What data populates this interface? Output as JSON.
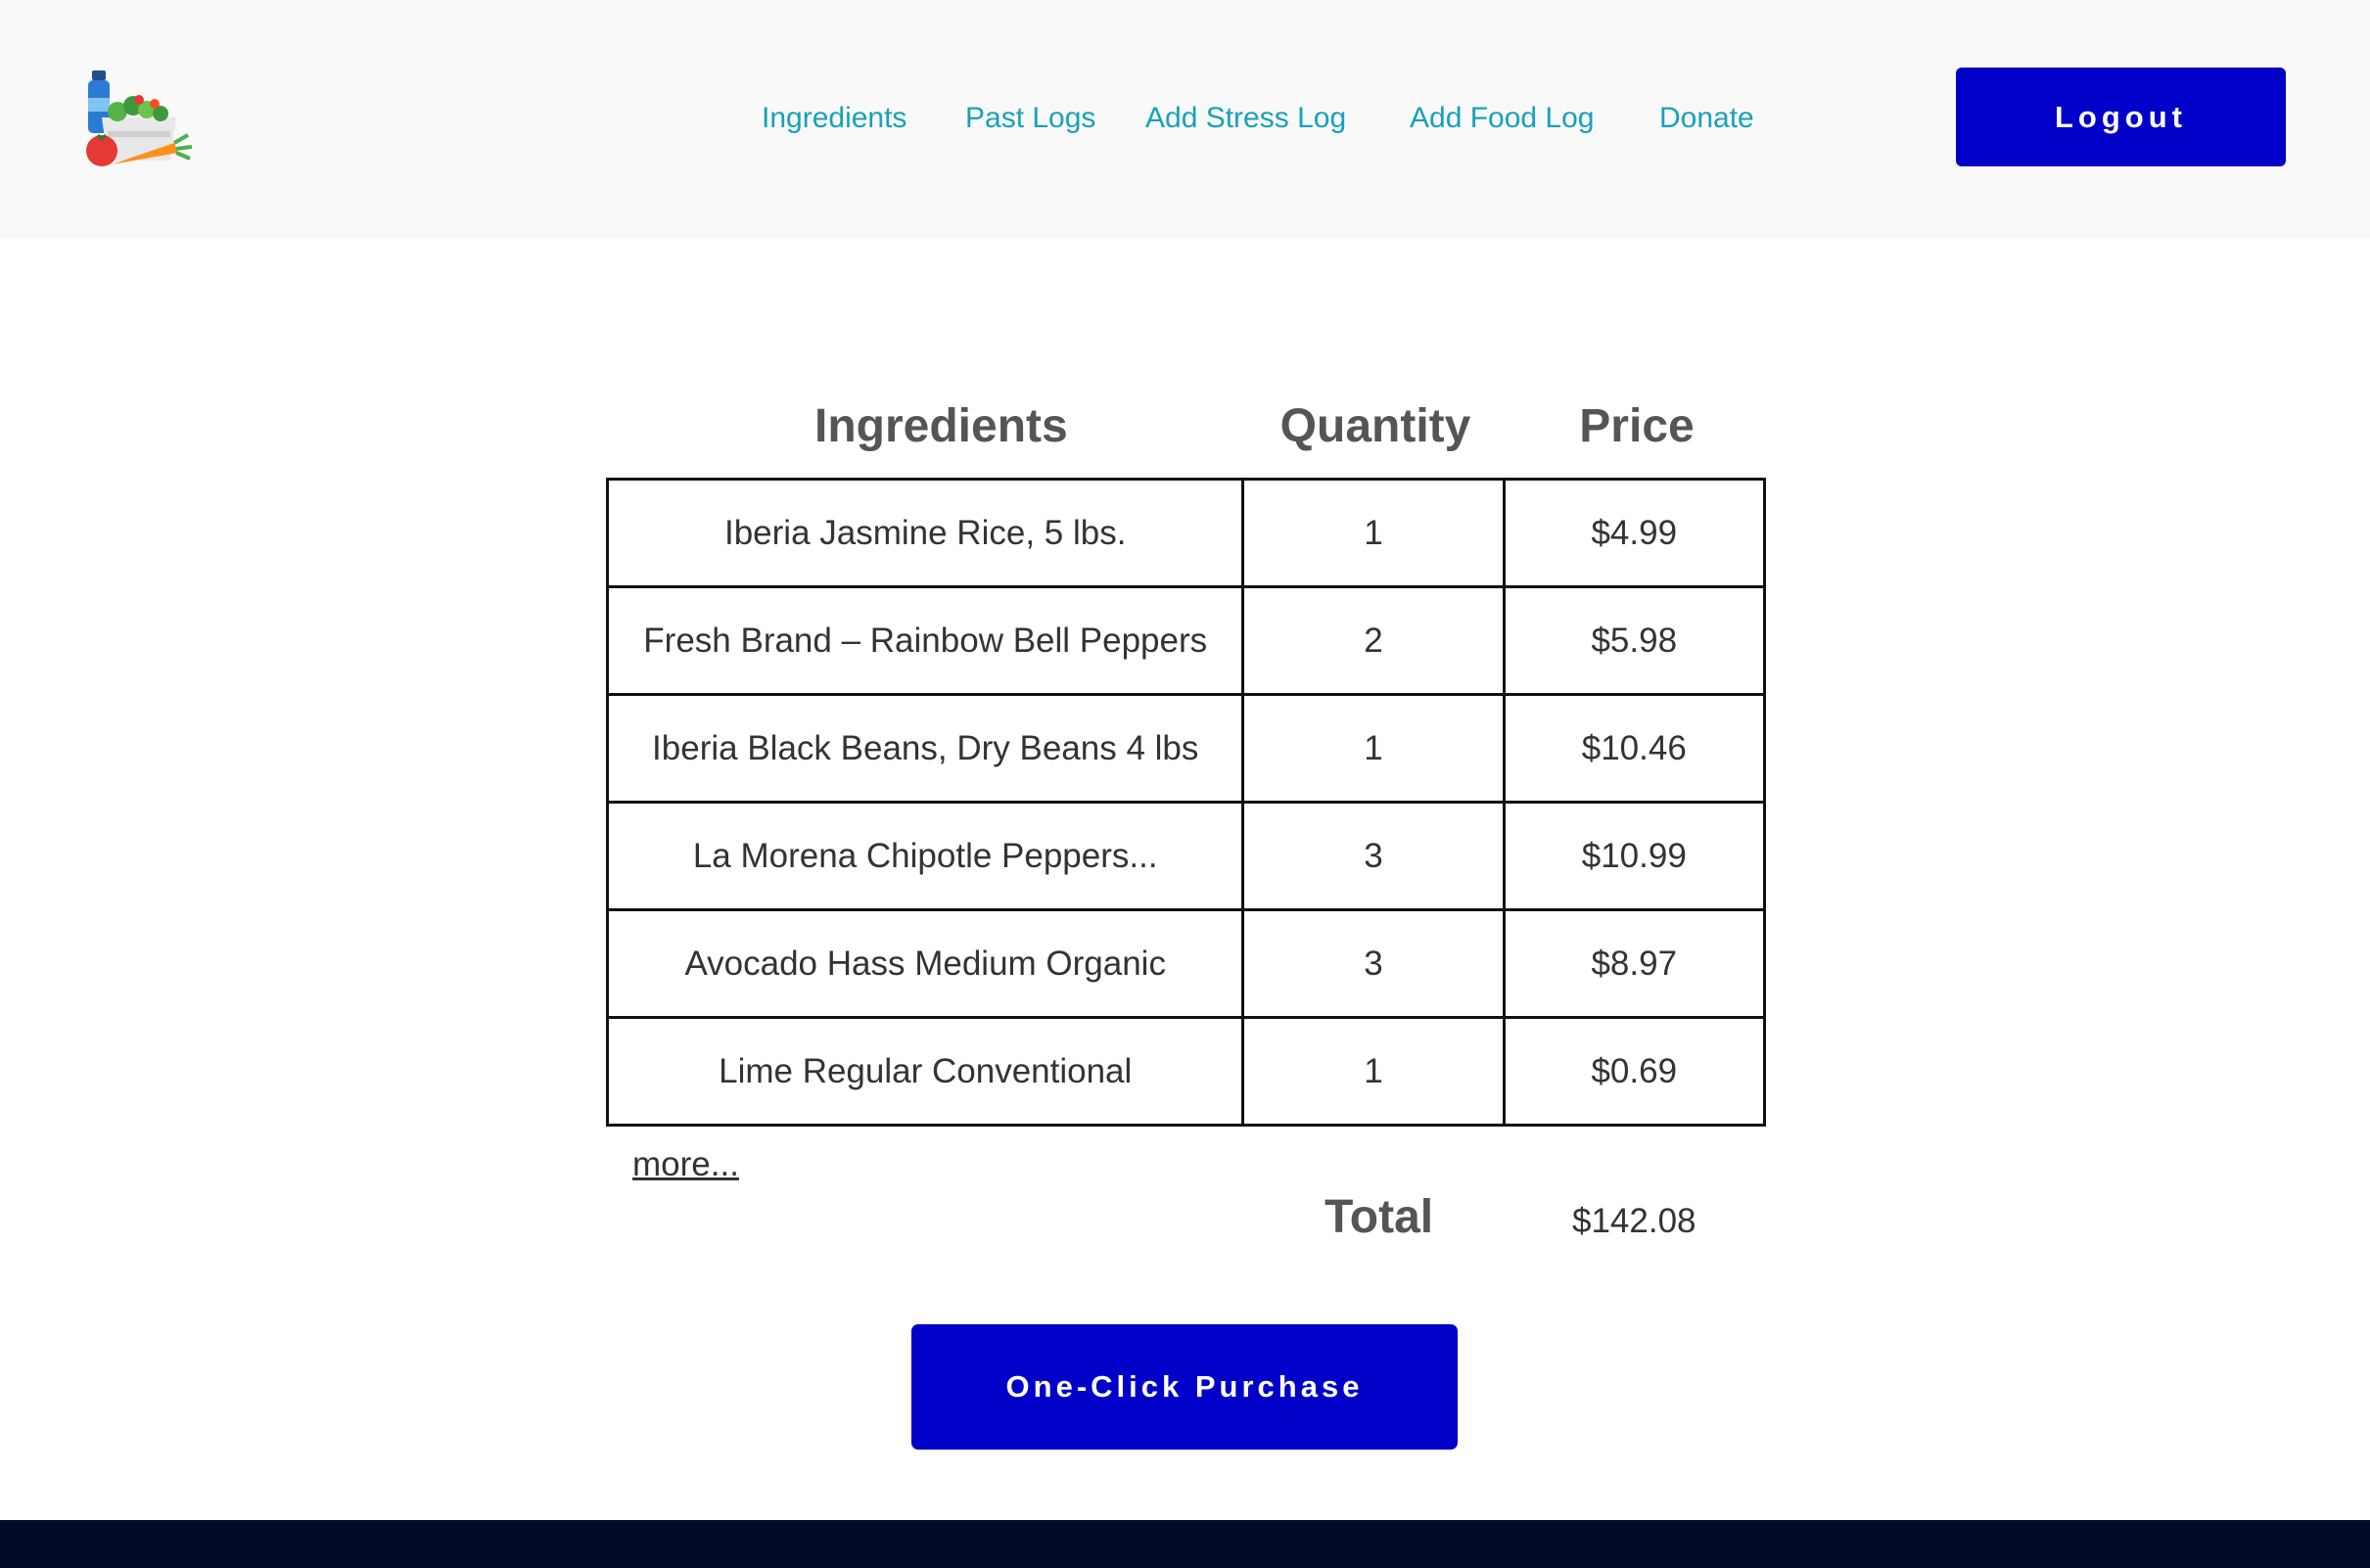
{
  "nav": {
    "links": [
      "Ingredients",
      "Past Logs",
      "Add Stress Log",
      "Add Food Log",
      "Donate"
    ],
    "logout_label": "Logout"
  },
  "logo": {
    "icon": "food-basket-logo-icon"
  },
  "table": {
    "headers": [
      "Ingredients",
      "Quantity",
      "Price"
    ],
    "rows": [
      {
        "name": "Iberia Jasmine Rice, 5 lbs.",
        "quantity": "1",
        "price": "$4.99"
      },
      {
        "name": "Fresh Brand – Rainbow Bell Peppers",
        "quantity": "2",
        "price": "$5.98"
      },
      {
        "name": "Iberia Black Beans, Dry Beans 4 lbs",
        "quantity": "1",
        "price": "$10.46"
      },
      {
        "name": "La Morena Chipotle Peppers...",
        "quantity": "3",
        "price": "$10.99"
      },
      {
        "name": "Avocado Hass Medium Organic",
        "quantity": "3",
        "price": "$8.97"
      },
      {
        "name": "Lime Regular Conventional",
        "quantity": "1",
        "price": "$0.69"
      }
    ],
    "more_label": "more...",
    "total_label": "Total",
    "total_value": "$142.08"
  },
  "purchase_label": "One-Click Purchase",
  "colors": {
    "nav_link": "#17a2b8",
    "button": "#0000c8",
    "header_bg": "#f9f9f9",
    "footer_bg": "#040b26"
  }
}
